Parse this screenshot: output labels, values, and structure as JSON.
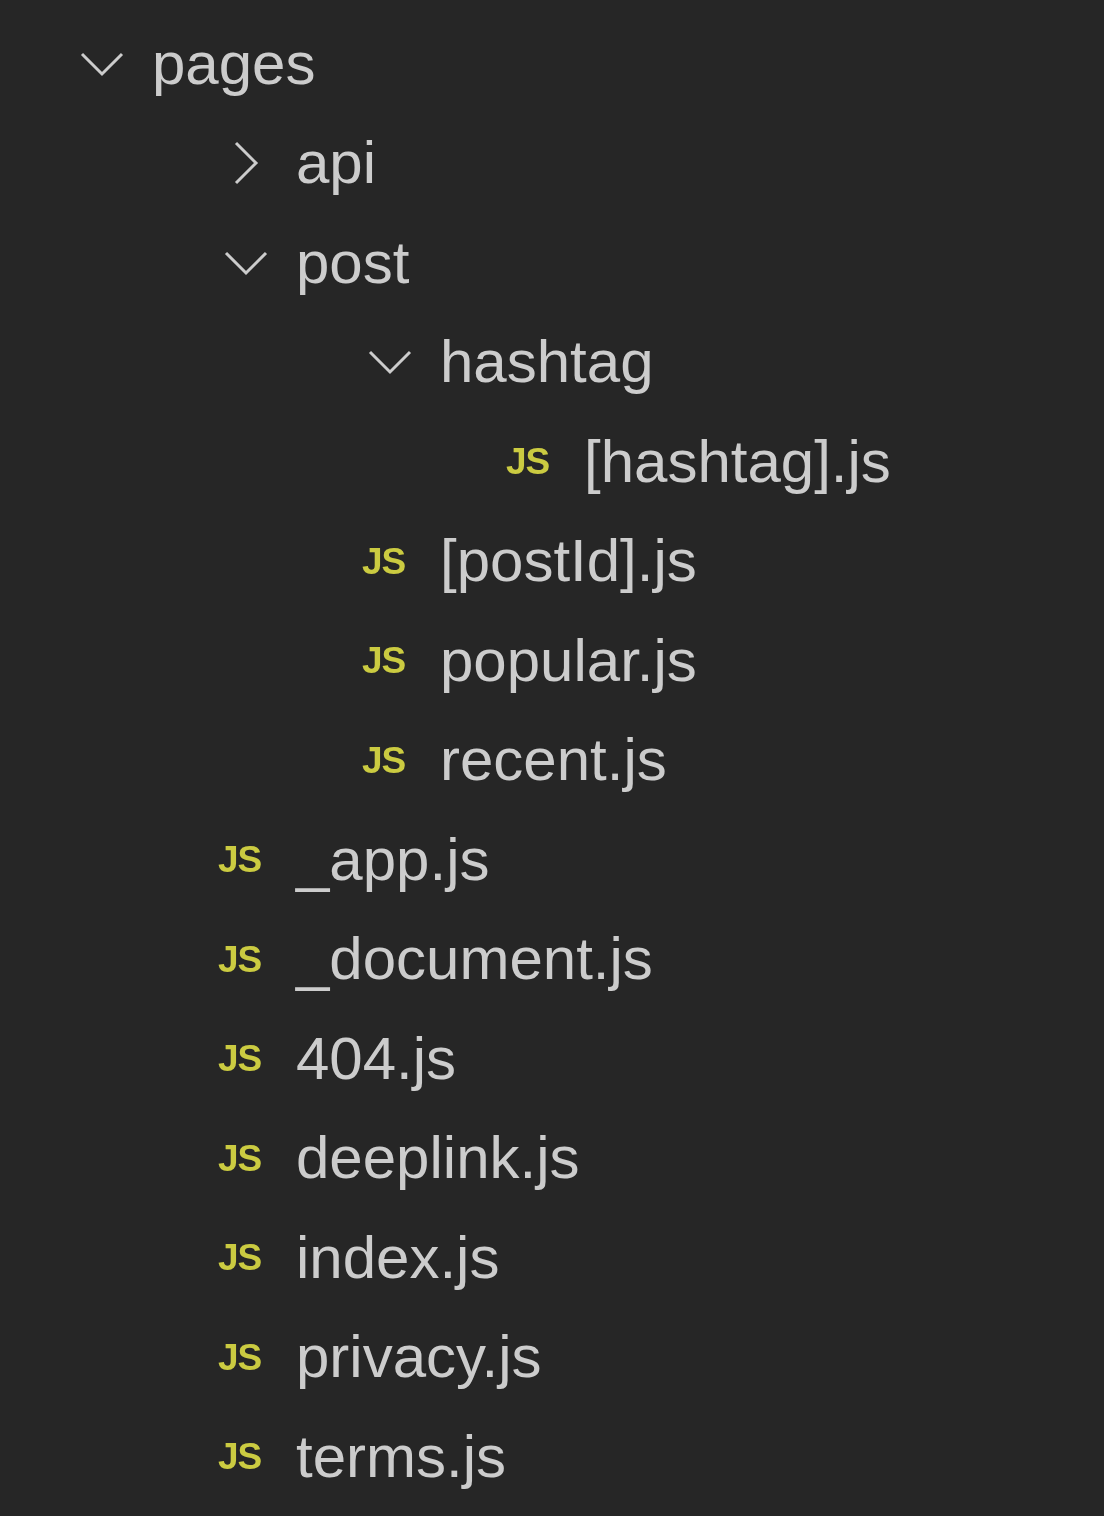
{
  "tree": [
    {
      "kind": "folder",
      "name": "pages",
      "expanded": true,
      "children": [
        {
          "kind": "folder",
          "name": "api",
          "expanded": false
        },
        {
          "kind": "folder",
          "name": "post",
          "expanded": true,
          "children": [
            {
              "kind": "folder",
              "name": "hashtag",
              "expanded": true,
              "children": [
                {
                  "kind": "file",
                  "icon": "JS",
                  "name": "[hashtag].js"
                }
              ]
            },
            {
              "kind": "file",
              "icon": "JS",
              "name": "[postId].js"
            },
            {
              "kind": "file",
              "icon": "JS",
              "name": "popular.js"
            },
            {
              "kind": "file",
              "icon": "JS",
              "name": "recent.js"
            }
          ]
        },
        {
          "kind": "file",
          "icon": "JS",
          "name": "_app.js"
        },
        {
          "kind": "file",
          "icon": "JS",
          "name": "_document.js"
        },
        {
          "kind": "file",
          "icon": "JS",
          "name": "404.js"
        },
        {
          "kind": "file",
          "icon": "JS",
          "name": "deeplink.js"
        },
        {
          "kind": "file",
          "icon": "JS",
          "name": "index.js"
        },
        {
          "kind": "file",
          "icon": "JS",
          "name": "privacy.js"
        },
        {
          "kind": "file",
          "icon": "JS",
          "name": "terms.js"
        }
      ]
    }
  ]
}
